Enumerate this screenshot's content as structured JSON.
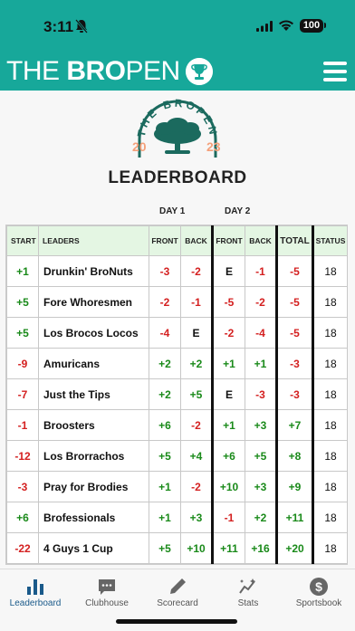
{
  "status": {
    "time": "3:11",
    "battery": "100"
  },
  "app": {
    "brand_thin": "THE ",
    "brand_bold": "BRO",
    "brand_tail": "PEN"
  },
  "logo": {
    "arc_text": "THE BROPEN",
    "year_left": "20",
    "year_right": "23"
  },
  "page": {
    "title": "LEADERBOARD"
  },
  "days": {
    "day1": "DAY 1",
    "day2": "DAY 2"
  },
  "table": {
    "headers": {
      "start": "START",
      "leaders": "LEADERS",
      "d1_front": "FRONT",
      "d1_back": "BACK",
      "d2_front": "FRONT",
      "d2_back": "BACK",
      "total": "TOTAL",
      "status": "STATUS"
    },
    "rows": [
      {
        "start": "+1",
        "name": "Drunkin' BroNuts",
        "d1f": "-3",
        "d1b": "-2",
        "d2f": "E",
        "d2b": "-1",
        "total": "-5",
        "status": "18"
      },
      {
        "start": "+5",
        "name": "Fore Whoresmen",
        "d1f": "-2",
        "d1b": "-1",
        "d2f": "-5",
        "d2b": "-2",
        "total": "-5",
        "status": "18"
      },
      {
        "start": "+5",
        "name": "Los Brocos Locos",
        "d1f": "-4",
        "d1b": "E",
        "d2f": "-2",
        "d2b": "-4",
        "total": "-5",
        "status": "18"
      },
      {
        "start": "-9",
        "name": "Amuricans",
        "d1f": "+2",
        "d1b": "+2",
        "d2f": "+1",
        "d2b": "+1",
        "total": "-3",
        "status": "18"
      },
      {
        "start": "-7",
        "name": "Just the Tips",
        "d1f": "+2",
        "d1b": "+5",
        "d2f": "E",
        "d2b": "-3",
        "total": "-3",
        "status": "18"
      },
      {
        "start": "-1",
        "name": "Broosters",
        "d1f": "+6",
        "d1b": "-2",
        "d2f": "+1",
        "d2b": "+3",
        "total": "+7",
        "status": "18"
      },
      {
        "start": "-12",
        "name": "Los Brorrachos",
        "d1f": "+5",
        "d1b": "+4",
        "d2f": "+6",
        "d2b": "+5",
        "total": "+8",
        "status": "18"
      },
      {
        "start": "-3",
        "name": "Pray for Brodies",
        "d1f": "+1",
        "d1b": "-2",
        "d2f": "+10",
        "d2b": "+3",
        "total": "+9",
        "status": "18"
      },
      {
        "start": "+6",
        "name": "Brofessionals",
        "d1f": "+1",
        "d1b": "+3",
        "d2f": "-1",
        "d2b": "+2",
        "total": "+11",
        "status": "18"
      },
      {
        "start": "-22",
        "name": "4 Guys 1 Cup",
        "d1f": "+5",
        "d1b": "+10",
        "d2f": "+11",
        "d2b": "+16",
        "total": "+20",
        "status": "18"
      }
    ]
  },
  "tabs": [
    {
      "label": "Leaderboard",
      "icon": "bar-chart-icon"
    },
    {
      "label": "Clubhouse",
      "icon": "chat-bubble-icon"
    },
    {
      "label": "Scorecard",
      "icon": "pencil-icon"
    },
    {
      "label": "Stats",
      "icon": "sparkle-chart-icon"
    },
    {
      "label": "Sportsbook",
      "icon": "dollar-coin-icon"
    }
  ],
  "colors": {
    "brand": "#17a89a",
    "positive": "#1a8a1a",
    "negative": "#d42020",
    "header_bg": "#e4f6e3",
    "logo_green": "#1b6a5e",
    "logo_peach": "#f4a07a",
    "active_tab": "#1a5a8a"
  }
}
